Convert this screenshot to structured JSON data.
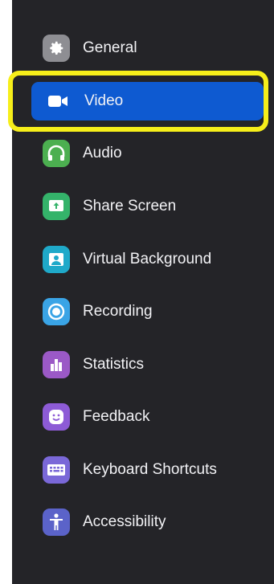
{
  "settings_menu": {
    "items": [
      {
        "label": "General",
        "icon": "gear-icon",
        "color": "#8e8e93"
      },
      {
        "label": "Video",
        "icon": "video-camera-icon",
        "color": "#0e5ad1",
        "selected": true
      },
      {
        "label": "Audio",
        "icon": "headphones-icon",
        "color": "#4caf50"
      },
      {
        "label": "Share Screen",
        "icon": "share-screen-icon",
        "color": "#34b36a"
      },
      {
        "label": "Virtual Background",
        "icon": "virtual-background-icon",
        "color": "#1fa9c9"
      },
      {
        "label": "Recording",
        "icon": "recording-icon",
        "color": "#3aa4e6"
      },
      {
        "label": "Statistics",
        "icon": "statistics-icon",
        "color": "#9b59c6"
      },
      {
        "label": "Feedback",
        "icon": "feedback-icon",
        "color": "#8d5bd6"
      },
      {
        "label": "Keyboard Shortcuts",
        "icon": "keyboard-icon",
        "color": "#7a68d8"
      },
      {
        "label": "Accessibility",
        "icon": "accessibility-icon",
        "color": "#5b63c9"
      }
    ]
  },
  "highlight_color": "#f6ee1a",
  "panel_color": "#242428"
}
